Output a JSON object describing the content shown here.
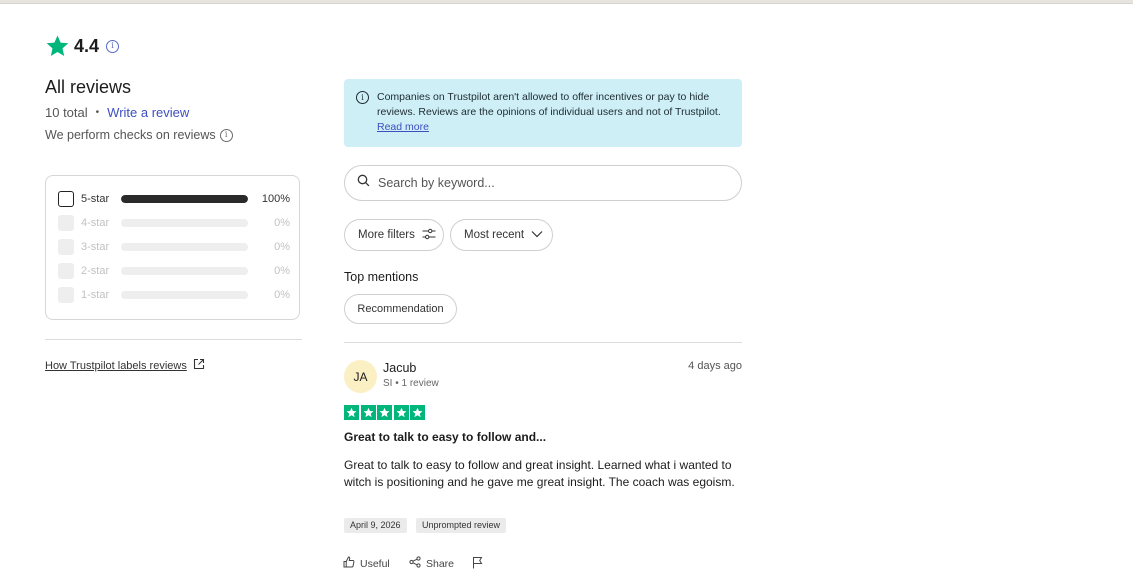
{
  "summary": {
    "rating": "4.4",
    "title": "All reviews",
    "total": "10 total",
    "write_review": "Write a review",
    "checks": "We perform checks on reviews"
  },
  "distribution": [
    {
      "label": "5-star",
      "percent_text": "100%",
      "fraction": 1.0,
      "active": true
    },
    {
      "label": "4-star",
      "percent_text": "0%",
      "fraction": 0.0,
      "active": false
    },
    {
      "label": "3-star",
      "percent_text": "0%",
      "fraction": 0.0,
      "active": false
    },
    {
      "label": "2-star",
      "percent_text": "0%",
      "fraction": 0.0,
      "active": false
    },
    {
      "label": "1-star",
      "percent_text": "0%",
      "fraction": 0.0,
      "active": false
    }
  ],
  "labels_link": "How Trustpilot labels reviews",
  "notice": {
    "text": "Companies on Trustpilot aren't allowed to offer incentives or pay to hide reviews. Reviews are the opinions of individual users and not of Trustpilot.",
    "read_more": "Read more"
  },
  "search": {
    "placeholder": "Search by keyword..."
  },
  "filters": {
    "more_filters": "More filters",
    "sort": "Most recent"
  },
  "top_mentions": {
    "title": "Top mentions",
    "items": [
      "Recommendation"
    ]
  },
  "review": {
    "initials": "JA",
    "name": "Jacub",
    "meta": "SI • 1 review",
    "relative_date": "4 days ago",
    "stars": 5,
    "title": "Great to talk to easy to follow and...",
    "body": "Great to talk to easy to follow and great insight. Learned what i wanted to witch is positioning and he gave me great insight. The coach was egoism.",
    "date": "April 9, 2026",
    "tag": "Unprompted review",
    "actions": {
      "useful": "Useful",
      "share": "Share"
    }
  },
  "colors": {
    "brand_green": "#00b67a",
    "notice_bg": "#cdeff5",
    "link_blue": "#3d4fbf",
    "avatar_bg": "#fbefc4"
  }
}
